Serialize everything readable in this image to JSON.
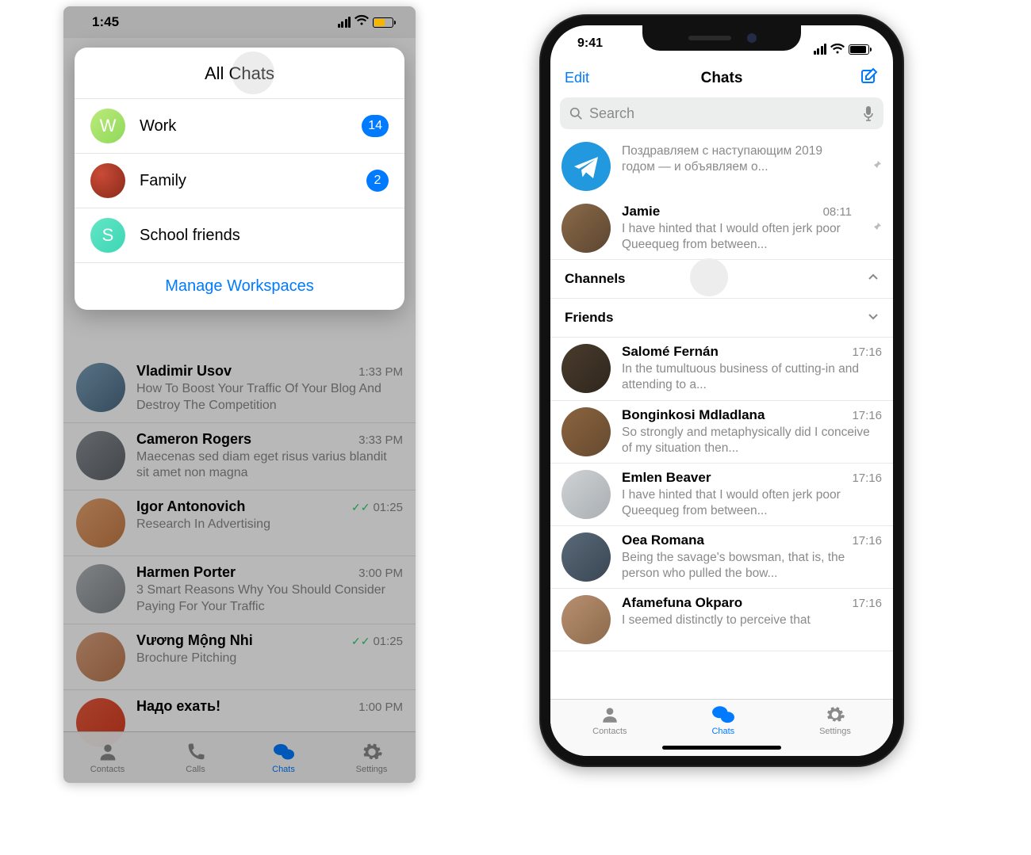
{
  "left": {
    "status_time": "1:45",
    "dropdown": {
      "title": "All Chats",
      "rows": [
        {
          "label": "Work",
          "initial": "W",
          "badge": "14",
          "avatar_class": "grad-green"
        },
        {
          "label": "Family",
          "initial": "",
          "badge": "2",
          "avatar_class": "photo1"
        },
        {
          "label": "School friends",
          "initial": "S",
          "badge": "",
          "avatar_class": "grad-teal"
        }
      ],
      "manage": "Manage Workspaces"
    },
    "chats": [
      {
        "name": "Vladimir Usov",
        "time": "1:33 PM",
        "preview": "How To Boost Your Traffic Of Your Blog And Destroy The Competition",
        "check": false,
        "avatar": "photo2"
      },
      {
        "name": "Cameron Rogers",
        "time": "3:33 PM",
        "preview": "Maecenas sed diam eget risus varius blandit sit amet non magna",
        "check": false,
        "avatar": "photo3"
      },
      {
        "name": "Igor Antonovich",
        "time": "01:25",
        "preview": "Research In Advertising",
        "check": true,
        "avatar": "photo4"
      },
      {
        "name": "Harmen Porter",
        "time": "3:00 PM",
        "preview": "3 Smart Reasons Why You Should Consider Paying For Your Traffic",
        "check": false,
        "avatar": "photo5"
      },
      {
        "name": "Vương Mộng Nhi",
        "time": "01:25",
        "preview": "Brochure Pitching",
        "check": true,
        "avatar": "photo6"
      },
      {
        "name": "Надо ехать!",
        "time": "1:00 PM",
        "preview": "",
        "check": false,
        "avatar": "photo7"
      }
    ],
    "tabs": [
      {
        "label": "Contacts"
      },
      {
        "label": "Calls"
      },
      {
        "label": "Chats"
      },
      {
        "label": "Settings"
      }
    ]
  },
  "right": {
    "status_time": "9:41",
    "nav": {
      "edit": "Edit",
      "title": "Chats"
    },
    "search_placeholder": "Search",
    "pinned": [
      {
        "name": "",
        "time": "",
        "preview": "Поздравляем с наступающим 2019 годом — и объявляем о...",
        "avatar": "telegram-av",
        "pin": true
      },
      {
        "name": "Jamie",
        "time": "08:11",
        "preview": "I have hinted that I would often jerk poor Queequeg from between...",
        "avatar": "photo8",
        "pin": true
      }
    ],
    "sections": [
      {
        "title": "Channels",
        "expanded": false
      },
      {
        "title": "Friends",
        "expanded": true
      }
    ],
    "friends": [
      {
        "name": "Salomé Fernán",
        "time": "17:16",
        "preview": "In the tumultuous business of cutting-in and attending to a...",
        "avatar": "photo9"
      },
      {
        "name": "Bonginkosi Mdladlana",
        "time": "17:16",
        "preview": "So strongly and metaphysically did I conceive of my situation then...",
        "avatar": "photo10"
      },
      {
        "name": "Emlen Beaver",
        "time": "17:16",
        "preview": "I have hinted that I would often jerk poor Queequeg from between...",
        "avatar": "photo11"
      },
      {
        "name": "Oea Romana",
        "time": "17:16",
        "preview": "Being the savage's bowsman, that is, the person who pulled the bow...",
        "avatar": "photo12"
      },
      {
        "name": "Afamefuna Okparo",
        "time": "17:16",
        "preview": "I seemed distinctly to perceive that",
        "avatar": "photo13"
      }
    ],
    "tabs": [
      {
        "label": "Contacts"
      },
      {
        "label": "Chats"
      },
      {
        "label": "Settings"
      }
    ]
  }
}
